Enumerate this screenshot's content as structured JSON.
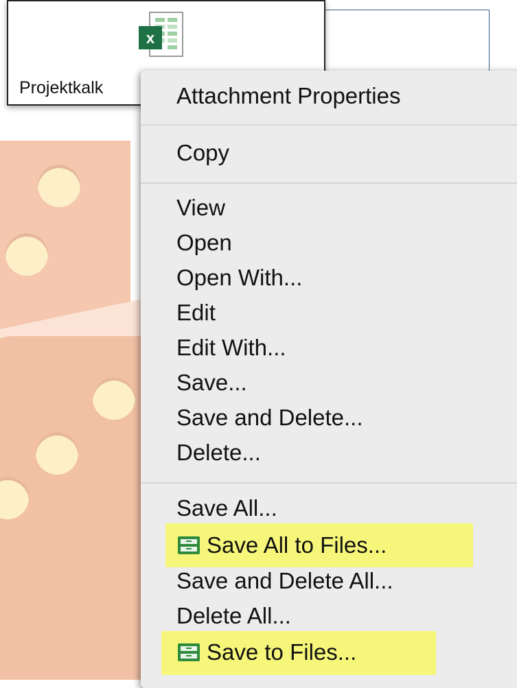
{
  "attachment": {
    "filename_visible": "Projektkalk",
    "icon": "excel-file-icon"
  },
  "menu": {
    "items": [
      {
        "label": "Attachment Properties"
      },
      {
        "label": "Copy"
      },
      {
        "label": "View"
      },
      {
        "label": "Open"
      },
      {
        "label": "Open With..."
      },
      {
        "label": "Edit"
      },
      {
        "label": "Edit With..."
      },
      {
        "label": "Save..."
      },
      {
        "label": "Save and Delete..."
      },
      {
        "label": "Delete..."
      },
      {
        "label": "Save All..."
      },
      {
        "label": "Save All to Files...",
        "icon": "files-cabinet-icon",
        "highlighted": true
      },
      {
        "label": "Save and Delete All..."
      },
      {
        "label": "Delete All..."
      },
      {
        "label": "Save to Files...",
        "icon": "files-cabinet-icon",
        "highlighted": true
      }
    ]
  },
  "colors": {
    "highlight": "#f6f77a",
    "menu_bg": "#ececec",
    "frame_blue": "#2f5d8a",
    "excel_green": "#1e7145"
  }
}
